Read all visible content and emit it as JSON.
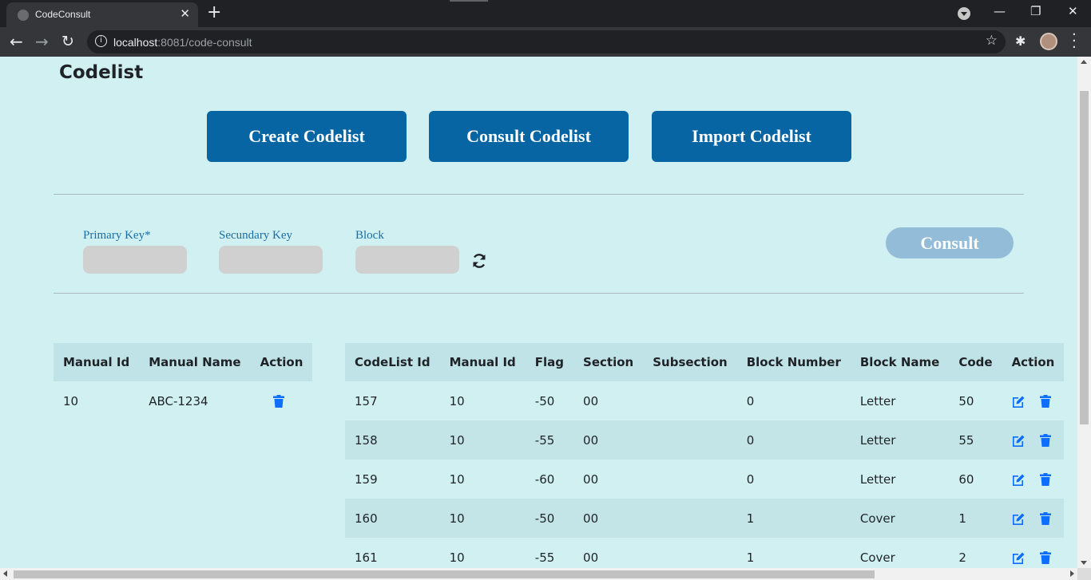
{
  "browser": {
    "tab_title": "CodeConsult",
    "new_tab": "+",
    "url_host": "localhost",
    "url_rest": ":8081/code-consult"
  },
  "page": {
    "title": "Codelist"
  },
  "actions": {
    "create": "Create Codelist",
    "consult": "Consult Codelist",
    "import": "Import Codelist"
  },
  "filters": {
    "primary_key_label": "Primary Key*",
    "secundary_key_label": "Secundary Key",
    "block_label": "Block",
    "primary_key_value": "",
    "secundary_key_value": "",
    "block_value": "",
    "consult_button": "Consult"
  },
  "manual_table": {
    "headers": [
      "Manual Id",
      "Manual Name",
      "Action"
    ],
    "rows": [
      {
        "manual_id": "10",
        "manual_name": "ABC-1234"
      }
    ]
  },
  "code_table": {
    "headers": [
      "CodeList Id",
      "Manual Id",
      "Flag",
      "Section",
      "Subsection",
      "Block Number",
      "Block Name",
      "Code",
      "Action"
    ],
    "rows": [
      [
        "157",
        "10",
        "-50",
        "00",
        "",
        "0",
        "Letter",
        "50"
      ],
      [
        "158",
        "10",
        "-55",
        "00",
        "",
        "0",
        "Letter",
        "55"
      ],
      [
        "159",
        "10",
        "-60",
        "00",
        "",
        "0",
        "Letter",
        "60"
      ],
      [
        "160",
        "10",
        "-50",
        "00",
        "",
        "1",
        "Cover",
        "1"
      ],
      [
        "161",
        "10",
        "-55",
        "00",
        "",
        "1",
        "Cover",
        "2"
      ]
    ]
  },
  "colors": {
    "page_bg": "#d0f0f2",
    "primary_button": "#0865a3",
    "disabled_button": "#93bcd8",
    "icon_blue": "#0d6efd"
  }
}
